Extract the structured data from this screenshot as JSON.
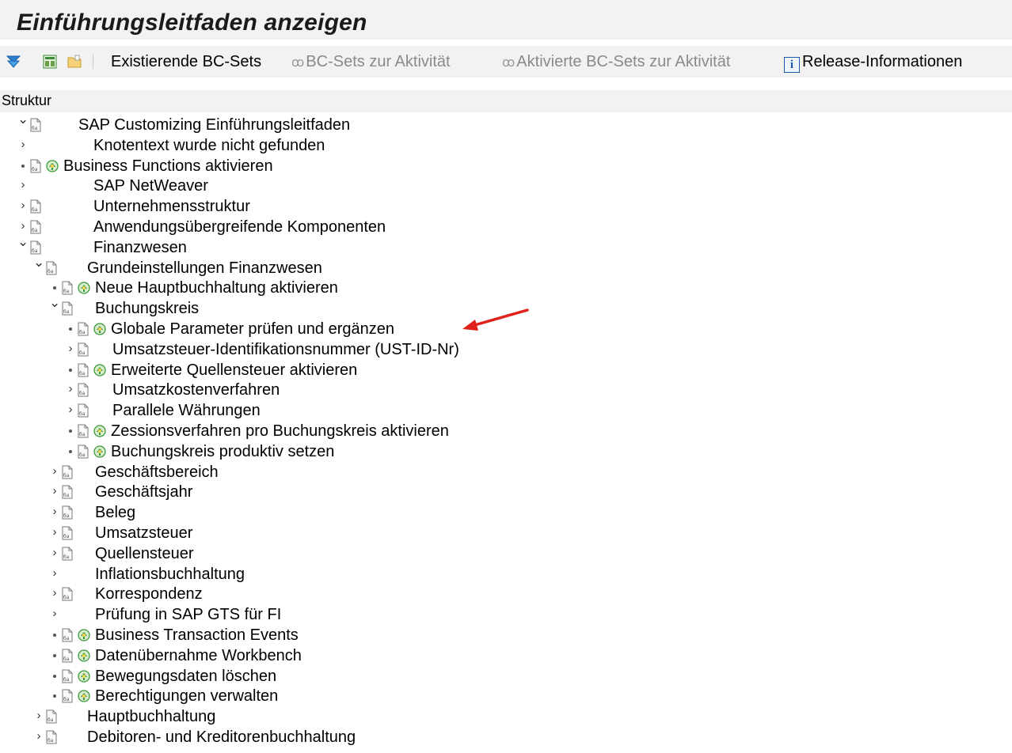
{
  "window": {
    "title": "Einführungsleitfaden anzeigen"
  },
  "toolbar": {
    "icons": [
      "filter-expand-icon",
      "transfer-icon",
      "folder-icon"
    ],
    "existing_bc_sets": "Existierende BC-Sets",
    "bc_sets_activity": "BC-Sets zur Aktivität",
    "activated_bc_sets_activity": "Aktivierte BC-Sets zur Aktivität",
    "release_info": "Release-Informationen"
  },
  "structure_header": "Struktur",
  "colors": {
    "arrow": "#e0201a",
    "activity_icon": "#3a9a3a",
    "info": "#1a5aa8"
  },
  "tree": [
    {
      "label": "SAP Customizing Einführungsleitfaden",
      "level": 0,
      "expander": "expanded",
      "doc": true,
      "activity": false
    },
    {
      "label": "Knotentext wurde nicht gefunden",
      "level": 1,
      "expander": "collapsed",
      "doc": false,
      "activity": false
    },
    {
      "label": "Business Functions aktivieren",
      "level": 1,
      "expander": "leaf",
      "doc": true,
      "activity": true
    },
    {
      "label": "SAP NetWeaver",
      "level": 1,
      "expander": "collapsed",
      "doc": false,
      "activity": false
    },
    {
      "label": "Unternehmensstruktur",
      "level": 1,
      "expander": "collapsed",
      "doc": true,
      "activity": false
    },
    {
      "label": "Anwendungsübergreifende Komponenten",
      "level": 1,
      "expander": "collapsed",
      "doc": true,
      "activity": false
    },
    {
      "label": "Finanzwesen",
      "level": 1,
      "expander": "expanded",
      "doc": true,
      "activity": false
    },
    {
      "label": "Grundeinstellungen Finanzwesen",
      "level": 2,
      "expander": "expanded",
      "doc": true,
      "activity": false
    },
    {
      "label": "Neue Hauptbuchhaltung aktivieren",
      "level": 3,
      "expander": "leaf",
      "doc": true,
      "activity": true
    },
    {
      "label": "Buchungskreis",
      "level": 3,
      "expander": "expanded",
      "doc": true,
      "activity": false
    },
    {
      "label": "Globale Parameter prüfen und ergänzen",
      "level": 4,
      "expander": "leaf",
      "doc": true,
      "activity": true
    },
    {
      "label": "Umsatzsteuer-Identifikationsnummer (UST-ID-Nr)",
      "level": 4,
      "expander": "collapsed",
      "doc": true,
      "activity": false
    },
    {
      "label": "Erweiterte Quellensteuer aktivieren",
      "level": 4,
      "expander": "leaf",
      "doc": true,
      "activity": true
    },
    {
      "label": "Umsatzkostenverfahren",
      "level": 4,
      "expander": "collapsed",
      "doc": true,
      "activity": false
    },
    {
      "label": "Parallele Währungen",
      "level": 4,
      "expander": "collapsed",
      "doc": true,
      "activity": false
    },
    {
      "label": "Zessionsverfahren pro Buchungskreis aktivieren",
      "level": 4,
      "expander": "leaf",
      "doc": true,
      "activity": true
    },
    {
      "label": "Buchungskreis produktiv setzen",
      "level": 4,
      "expander": "leaf",
      "doc": true,
      "activity": true
    },
    {
      "label": "Geschäftsbereich",
      "level": 3,
      "expander": "collapsed",
      "doc": true,
      "activity": false
    },
    {
      "label": "Geschäftsjahr",
      "level": 3,
      "expander": "collapsed",
      "doc": true,
      "activity": false
    },
    {
      "label": "Beleg",
      "level": 3,
      "expander": "collapsed",
      "doc": true,
      "activity": false
    },
    {
      "label": "Umsatzsteuer",
      "level": 3,
      "expander": "collapsed",
      "doc": true,
      "activity": false
    },
    {
      "label": "Quellensteuer",
      "level": 3,
      "expander": "collapsed",
      "doc": true,
      "activity": false
    },
    {
      "label": "Inflationsbuchhaltung",
      "level": 3,
      "expander": "collapsed",
      "doc": false,
      "activity": false
    },
    {
      "label": "Korrespondenz",
      "level": 3,
      "expander": "collapsed",
      "doc": true,
      "activity": false
    },
    {
      "label": "Prüfung in SAP GTS für FI",
      "level": 3,
      "expander": "collapsed",
      "doc": false,
      "activity": false
    },
    {
      "label": "Business Transaction Events",
      "level": 3,
      "expander": "leaf",
      "doc": true,
      "activity": true
    },
    {
      "label": "Datenübernahme Workbench",
      "level": 3,
      "expander": "leaf",
      "doc": true,
      "activity": true
    },
    {
      "label": "Bewegungsdaten löschen",
      "level": 3,
      "expander": "leaf",
      "doc": true,
      "activity": true
    },
    {
      "label": "Berechtigungen verwalten",
      "level": 3,
      "expander": "leaf",
      "doc": true,
      "activity": true
    },
    {
      "label": "Hauptbuchhaltung",
      "level": 2,
      "expander": "collapsed",
      "doc": true,
      "activity": false
    },
    {
      "label": "Debitoren- und Kreditorenbuchhaltung",
      "level": 2,
      "expander": "collapsed",
      "doc": true,
      "activity": false
    }
  ]
}
